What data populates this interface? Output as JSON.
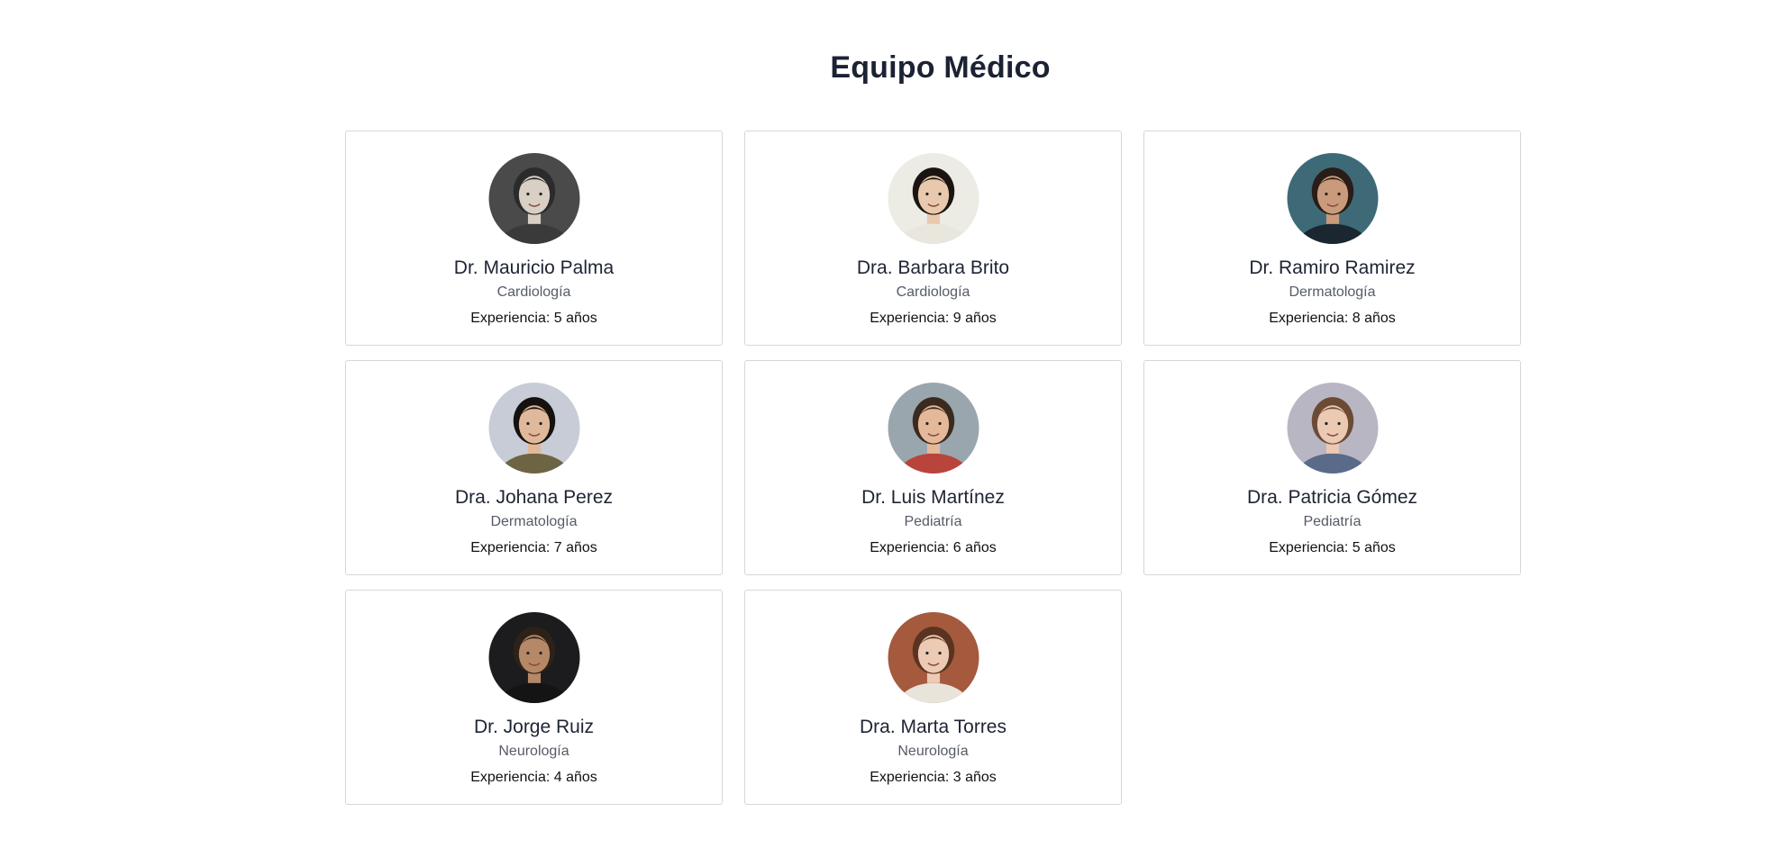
{
  "page": {
    "title": "Equipo Médico"
  },
  "doctors": [
    {
      "name": "Dr. Mauricio Palma",
      "specialty": "Cardiología",
      "experience": "Experiencia: 5 años",
      "avatar_icon": "doctor-photo-mauricio-palma",
      "bg": "#4a4a4a",
      "skin": "#d9cfc5",
      "hair": "#2b2b2b",
      "shirt": "#3a3a3a"
    },
    {
      "name": "Dra. Barbara Brito",
      "specialty": "Cardiología",
      "experience": "Experiencia: 9 años",
      "avatar_icon": "doctor-photo-barbara-brito",
      "bg": "#ecebe4",
      "skin": "#e8c9ae",
      "hair": "#1c1410",
      "shirt": "#e9e6de"
    },
    {
      "name": "Dr. Ramiro Ramirez",
      "specialty": "Dermatología",
      "experience": "Experiencia: 8 años",
      "avatar_icon": "doctor-photo-ramiro-ramirez",
      "bg": "#3e6a78",
      "skin": "#c99a7c",
      "hair": "#2a1c16",
      "shirt": "#1b2730"
    },
    {
      "name": "Dra. Johana Perez",
      "specialty": "Dermatología",
      "experience": "Experiencia: 7 años",
      "avatar_icon": "doctor-photo-johana-perez",
      "bg": "#c7ccd6",
      "skin": "#e0b99a",
      "hair": "#15110f",
      "shirt": "#6d6443"
    },
    {
      "name": "Dr. Luis Martínez",
      "specialty": "Pediatría",
      "experience": "Experiencia: 6 años",
      "avatar_icon": "doctor-photo-luis-martinez",
      "bg": "#9aa6ad",
      "skin": "#e4b99a",
      "hair": "#3b2a1e",
      "shirt": "#b8443c"
    },
    {
      "name": "Dra. Patricia Gómez",
      "specialty": "Pediatría",
      "experience": "Experiencia: 5 años",
      "avatar_icon": "doctor-photo-patricia-gomez",
      "bg": "#b9b6c4",
      "skin": "#ecc9b3",
      "hair": "#6b4a36",
      "shirt": "#5a6b8a"
    },
    {
      "name": "Dr. Jorge Ruiz",
      "specialty": "Neurología",
      "experience": "Experiencia: 4 años",
      "avatar_icon": "doctor-photo-jorge-ruiz",
      "bg": "#1c1c1e",
      "skin": "#b58868",
      "hair": "#2e2118",
      "shirt": "#141414"
    },
    {
      "name": "Dra. Marta Torres",
      "specialty": "Neurología",
      "experience": "Experiencia: 3 años",
      "avatar_icon": "doctor-photo-marta-torres",
      "bg": "#a5593d",
      "skin": "#eccab3",
      "hair": "#5a3420",
      "shirt": "#e9e4da"
    }
  ]
}
